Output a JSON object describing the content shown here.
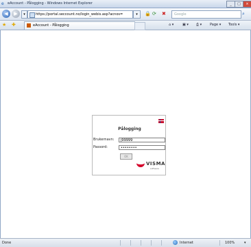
{
  "window": {
    "title": "eAccount - Pålogging - Windows Internet Explorer",
    "buttons": [
      "_",
      "□",
      "×"
    ]
  },
  "navbar": {
    "address": "https://portal.seccount.no/login_webis.asp?acnos=",
    "search_placeholder": "Google"
  },
  "tabbar": {
    "tab_label": "eAccount - Pålogging",
    "commands": [
      "Page ▾",
      "Tools ▾"
    ]
  },
  "login": {
    "title": "Pålogging",
    "username_label": "Brukernavn:",
    "username_value": "j99999",
    "password_label": "Passord:",
    "password_value": "••••••••",
    "ok_label": "OK",
    "brand_name": "VISMA",
    "brand_sub": "software"
  },
  "statusbar": {
    "left": "Done",
    "zone": "Internet",
    "zoom": "100%"
  }
}
